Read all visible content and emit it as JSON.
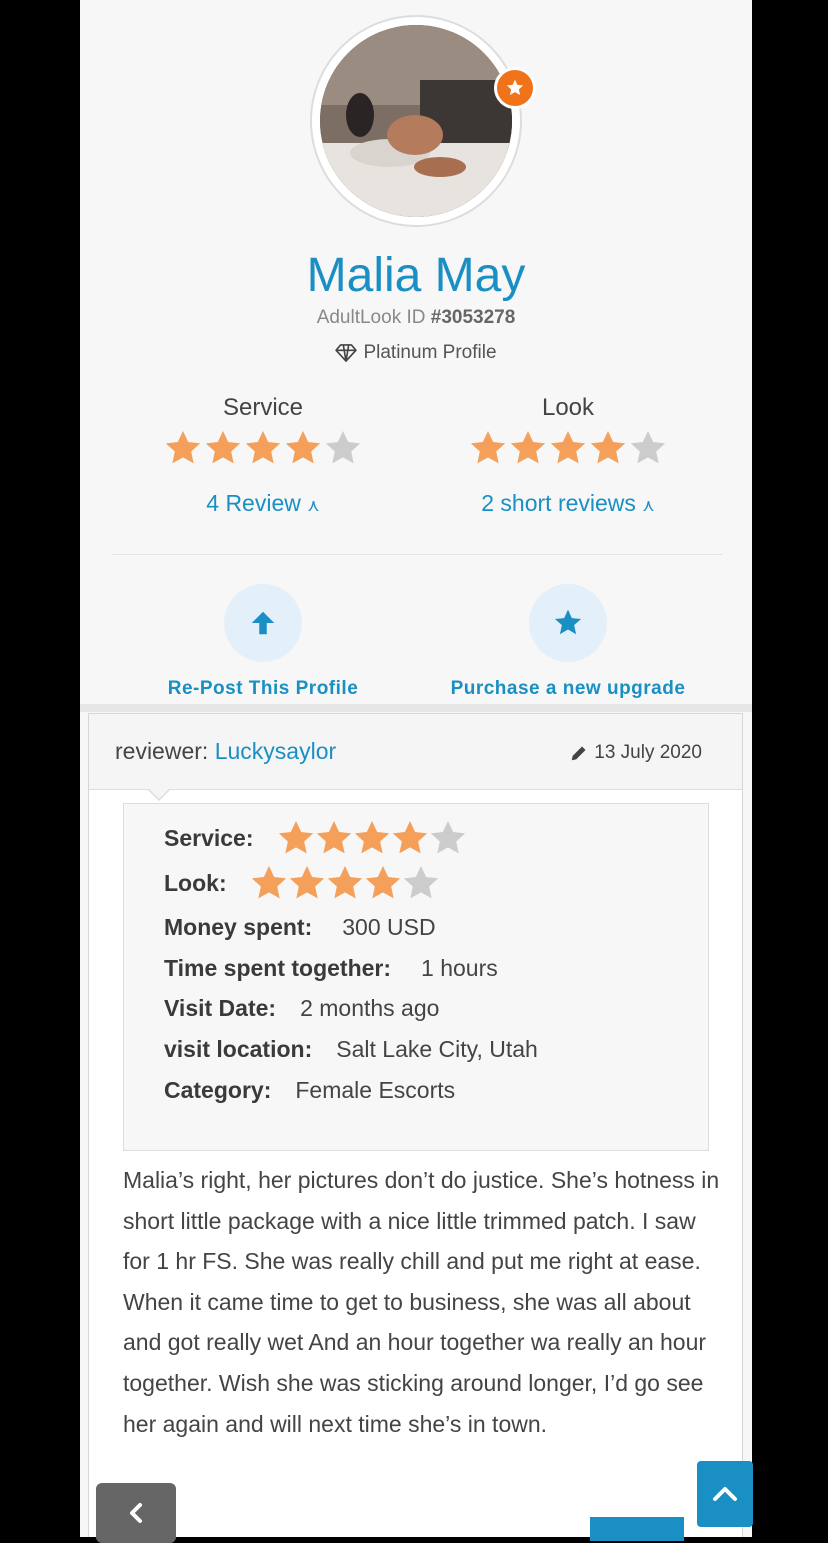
{
  "profile": {
    "name": "Malia May",
    "id_label": "AdultLook ID",
    "id_value": "#3053278",
    "tier_label": "Platinum Profile"
  },
  "ratings": {
    "service": {
      "label": "Service",
      "stars": 4,
      "max": 5,
      "link_label": "4 Review"
    },
    "look": {
      "label": "Look",
      "stars": 4,
      "max": 5,
      "link_label": "2 short reviews"
    }
  },
  "actions": {
    "repost_label": "Re-Post This Profile",
    "upgrade_label": "Purchase a new upgrade"
  },
  "review": {
    "reviewer_prefix": "reviewer:",
    "reviewer_name": "Luckysaylor",
    "date": "13 July 2020",
    "service_label": "Service:",
    "service_stars": 4,
    "look_label": "Look:",
    "look_stars": 4,
    "money_label": "Money spent:",
    "money_value": "300 USD",
    "time_label": "Time spent together:",
    "time_value": "1 hours",
    "visit_label": "Visit Date:",
    "visit_value": "2 months ago",
    "location_label": "visit location:",
    "location_value": "Salt Lake City, Utah",
    "category_label": "Category:",
    "category_value": "Female Escorts",
    "text": "Malia’s right, her pictures don’t do justice. She’s hotness in short little package with a nice little trimmed patch. I saw for 1 hr FS. She was really chill and put me right at ease. When it came time to get to business, she was all about and got really wet And an hour together wa really an hour together. Wish she was sticking around longer, I’d go see her again and will next time she’s in town."
  },
  "colors": {
    "accent": "#1a8fc3",
    "star_on": "#f5a05a",
    "star_off": "#cccccc",
    "badge": "#f07319"
  },
  "icons": {
    "badge": "star-icon",
    "tier": "diamond-icon",
    "repost": "arrow-up-icon",
    "upgrade": "star-icon",
    "date": "pencil-icon",
    "back": "chevron-left-icon",
    "top": "chevron-up-icon"
  }
}
